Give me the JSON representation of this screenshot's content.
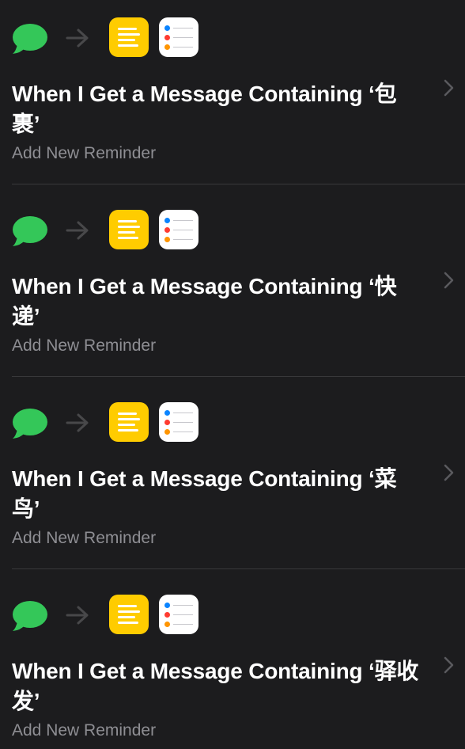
{
  "automations": [
    {
      "title": "When I Get a Message Containing ‘包裹’",
      "subtitle": "Add New Reminder",
      "icons": [
        "messages-icon",
        "arrow-right-icon",
        "notes-icon",
        "reminders-icon"
      ]
    },
    {
      "title": "When I Get a Message Containing ‘快递’",
      "subtitle": "Add New Reminder",
      "icons": [
        "messages-icon",
        "arrow-right-icon",
        "notes-icon",
        "reminders-icon"
      ]
    },
    {
      "title": "When I Get a Message Containing ‘菜鸟’",
      "subtitle": "Add New Reminder",
      "icons": [
        "messages-icon",
        "arrow-right-icon",
        "notes-icon",
        "reminders-icon"
      ]
    },
    {
      "title": "When I Get a Message Containing ‘驿收发’",
      "subtitle": "Add New Reminder",
      "icons": [
        "messages-icon",
        "arrow-right-icon",
        "notes-icon",
        "reminders-icon"
      ]
    }
  ],
  "colors": {
    "background": "#1c1c1e",
    "messages_green": "#34c759",
    "notes_yellow": "#ffcc00",
    "reminder_blue": "#0a84ff",
    "reminder_red": "#ff3b30",
    "reminder_orange": "#ff9500",
    "subtitle_gray": "#8e8e93"
  }
}
